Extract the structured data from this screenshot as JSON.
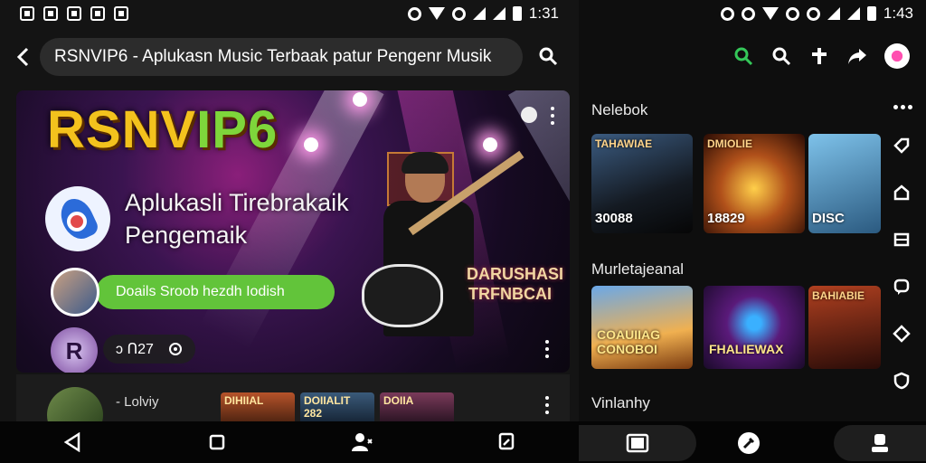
{
  "left": {
    "status": {
      "time": "1:31"
    },
    "search": {
      "query": "RSNVIP6 - Aplukasn Music Terbaak patur Pengenr Musik"
    },
    "hero": {
      "brand_a": "RSNV",
      "brand_b": "IP6",
      "title": "Aplukasli Tirebrakaik Pengemaik",
      "cta_label": "Doails Sroob hezdh Iodish",
      "stats": "ↄ ᑎ27",
      "poster_text": "DARUSHASI TRFNBCAI"
    },
    "row2": {
      "title": "- Lolviy",
      "thumbs": [
        "DIHIIAL",
        "DOIIALIT 282",
        "DOIIA"
      ]
    }
  },
  "right": {
    "status": {
      "time": "1:43"
    },
    "sections": [
      {
        "title": "Nelebok",
        "cards": [
          {
            "top": "TAHAWIAE",
            "label": "30088"
          },
          {
            "top": "DMIOLIE",
            "label": "18829"
          },
          {
            "top": "",
            "label": "DISC"
          }
        ]
      },
      {
        "title": "Murletajeanal",
        "cards": [
          {
            "top": "",
            "label": "COAUIIAG CONOBOI"
          },
          {
            "top": "",
            "label": "FHALIEWAX"
          },
          {
            "top": "BAHIABIE",
            "label": ""
          }
        ]
      },
      {
        "title": "Vinlanhy"
      }
    ]
  },
  "colors": {
    "accent_green": "#62c43a",
    "brand_yellow": "#f3c21d",
    "search_green": "#34c759"
  }
}
